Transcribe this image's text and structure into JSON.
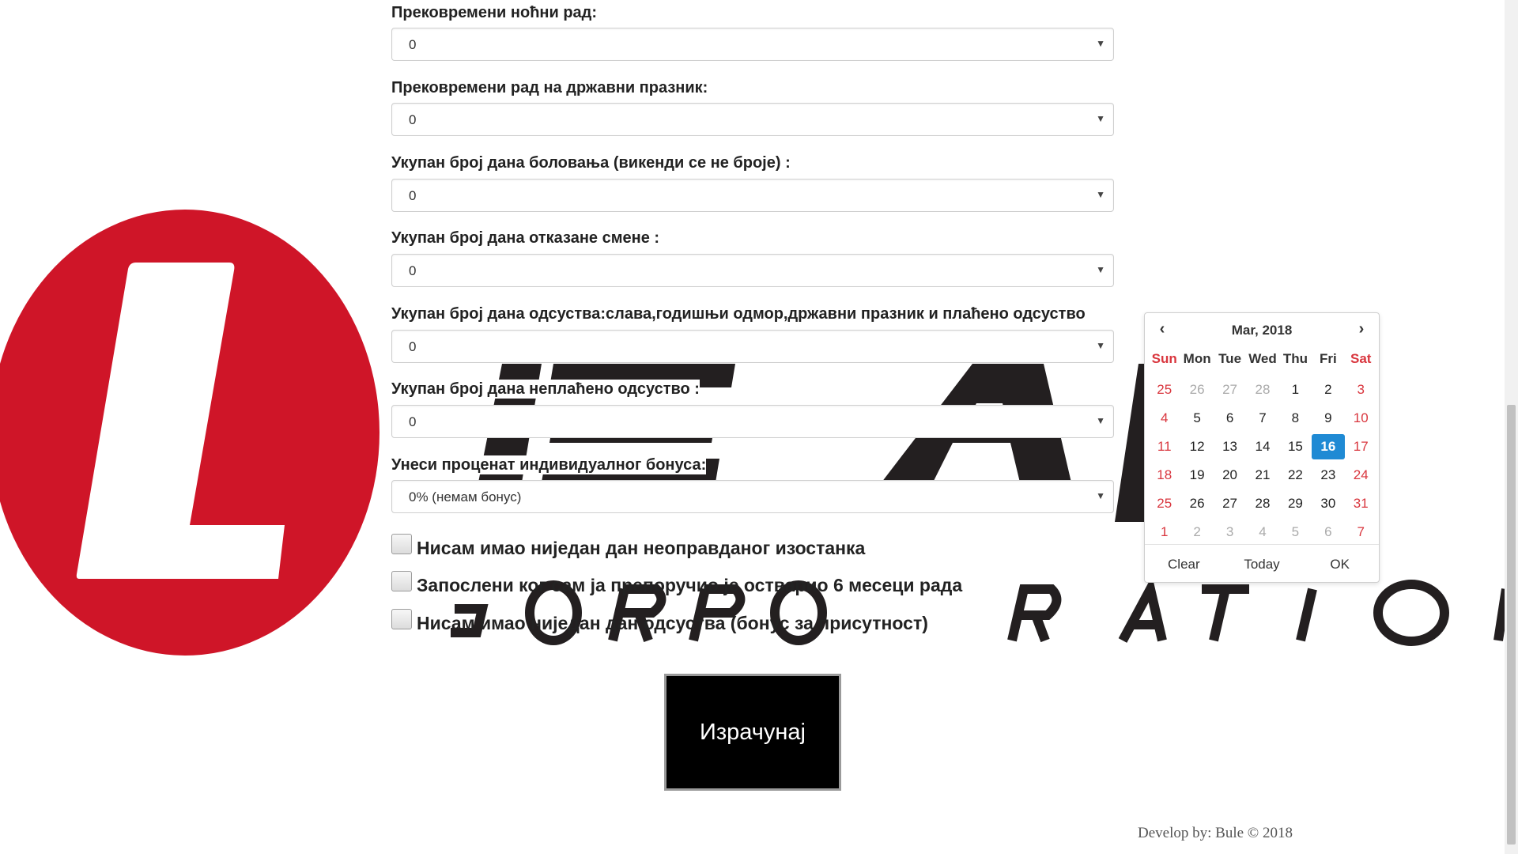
{
  "fields": [
    {
      "label": "Прековремени ноћни рад:",
      "value": "0"
    },
    {
      "label": "Прековремени рад на државни празник:",
      "value": "0"
    },
    {
      "label": "Укупан број дана боловања (викенди се не броје) :",
      "value": "0"
    },
    {
      "label": "Укупан број дана отказане смене :",
      "value": "0"
    },
    {
      "label": "Укупан број дана одсуства:слава,годишњи одмор,државни празник и плаћено одсуство",
      "value": "0"
    },
    {
      "label": "Укупан број дана неплаћено одсуство :",
      "value": "0"
    },
    {
      "label": "Унеси проценат индивидуалног бонуса:",
      "value": "0% (немам бонус)"
    }
  ],
  "checkboxes": [
    {
      "label": "Нисам имао ниједан дан неоправданог изостанка",
      "checked": false
    },
    {
      "label": "Запослени ког сам ја препоручио је остварио 6 месеци рада",
      "checked": false
    },
    {
      "label": "Нисам имао ниједан дан одсуства (бонус за присутност)",
      "checked": false
    }
  ],
  "calculate_label": "Израчунај",
  "footer": "Develop by: Bule © 2018",
  "datepicker": {
    "title": "Mar, 2018",
    "prev_icon": "chevron-left-icon",
    "next_icon": "chevron-right-icon",
    "weekdays": [
      "Sun",
      "Mon",
      "Tue",
      "Wed",
      "Thu",
      "Fri",
      "Sat"
    ],
    "weeks": [
      [
        "25",
        "26",
        "27",
        "28",
        "1",
        "2",
        "3"
      ],
      [
        "4",
        "5",
        "6",
        "7",
        "8",
        "9",
        "10"
      ],
      [
        "11",
        "12",
        "13",
        "14",
        "15",
        "16",
        "17"
      ],
      [
        "18",
        "19",
        "20",
        "21",
        "22",
        "23",
        "24"
      ],
      [
        "25",
        "26",
        "27",
        "28",
        "29",
        "30",
        "31"
      ],
      [
        "1",
        "2",
        "3",
        "4",
        "5",
        "6",
        "7"
      ]
    ],
    "selected": "16",
    "buttons": {
      "clear": "Clear",
      "today": "Today",
      "ok": "OK"
    }
  },
  "colors": {
    "weekend": "#d9363e",
    "selected": "#1f8ad4",
    "logo_red": "#cf1528",
    "logo_dark": "#231f20"
  },
  "background_logo": {
    "text_top": "LEAR",
    "text_bottom": "CORPORATION"
  }
}
